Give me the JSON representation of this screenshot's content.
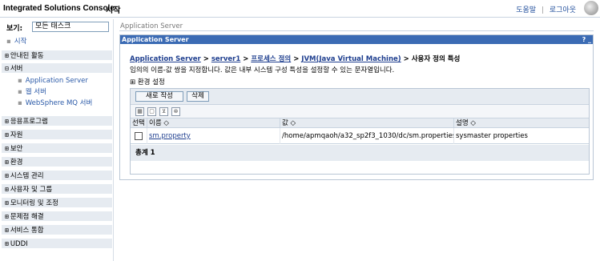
{
  "banner": {
    "product": "Integrated Solutions Console",
    "home": "시작",
    "help": "도움말",
    "sep": "|",
    "logout": "로그아웃"
  },
  "nav": {
    "view_label": "보기:",
    "view_value": "모든 태스크",
    "start": "시작",
    "items": [
      {
        "label": "안내된 활동"
      },
      {
        "label": "서버"
      },
      {
        "label": "응용프로그램"
      },
      {
        "label": "자원"
      },
      {
        "label": "보안"
      },
      {
        "label": "환경"
      },
      {
        "label": "시스템 관리"
      },
      {
        "label": "사용자 및 그룹"
      },
      {
        "label": "모니터링 및 조정"
      },
      {
        "label": "문제점 해결"
      },
      {
        "label": "서비스 통합"
      },
      {
        "label": "UDDI"
      }
    ],
    "server_sub": [
      {
        "label": "Application Server"
      },
      {
        "label": "웹 서버"
      },
      {
        "label": "WebSphere MQ 서버"
      }
    ],
    "plus": "⊞",
    "minus": "⊟",
    "bullet": "▪"
  },
  "main": {
    "top_crumb": "Application Server",
    "portlet_title": "Application Server",
    "portlet_ctrl": "? _",
    "breadcrumb": {
      "l1": "Application Server",
      "l2": "server1",
      "l3": "프로세스 정의",
      "l4": "JVM(Java Virtual Machine)",
      "current": "사용자 정의 특성",
      "sep": ">"
    },
    "description": "임의의 이름-값 쌍을 지정합니다. 값은 내부 시스템 구성 특성을 설정할 수 있는 문자열입니다.",
    "preferences": "⊞ 환경 설정",
    "buttons": {
      "new": "새로 작성",
      "delete": "삭제"
    },
    "icons": [
      "select-all",
      "deselect-all",
      "filter",
      "clear-filter"
    ],
    "columns": {
      "select": "선택",
      "name": "이름 ◇",
      "value": "값 ◇",
      "desc": "설명 ◇"
    },
    "rows": [
      {
        "name": "sm.property",
        "value": "/home/apmqaoh/a32_sp2f3_1030/dc/sm.properties7",
        "description": "sysmaster properties"
      }
    ],
    "total": "총계 1"
  }
}
